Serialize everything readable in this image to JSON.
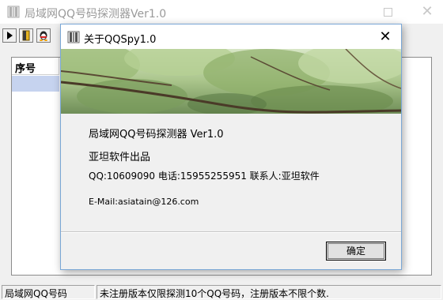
{
  "main_window": {
    "title": "局域网QQ号码探测器Ver1.0",
    "list_header": "序号",
    "status_left": "局域网QQ号码",
    "status_right": "未注册版本仅限探测10个QQ号码，注册版本不限个数."
  },
  "dialog": {
    "title": "关于QQSpy1.0",
    "product_line": "局域网QQ号码探测器 Ver1.0",
    "publisher_line": "亚坦软件出品",
    "contact_line": "QQ:10609090  电话:15955255951  联系人:亚坦软件",
    "email_line": "E-Mail:asiatain@126.com",
    "ok_label": "确定"
  },
  "icons": {
    "app_icon": "book-icon",
    "close_icon": "close-icon",
    "maximize_icon": "maximize-icon",
    "play_icon": "play-icon",
    "exit_icon": "door-icon",
    "qq_icon": "qq-penguin-icon"
  }
}
